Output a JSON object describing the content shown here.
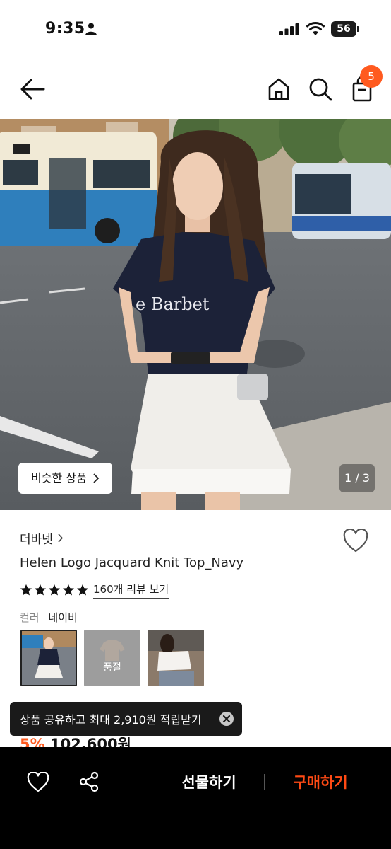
{
  "status_bar": {
    "time": "9:35",
    "battery": "56"
  },
  "nav": {
    "cart_count": "5"
  },
  "hero": {
    "similar_label": "비슷한 상품",
    "page_indicator": "1 / 3",
    "shirt_text": "e Barbet"
  },
  "product": {
    "brand": "더바넷",
    "name": "Helen Logo Jacquard Knit Top_Navy",
    "rating_stars": 5,
    "review_link": "160개 리뷰 보기",
    "color_key": "컬러",
    "color_value": "네이비",
    "soldout_label": "품절",
    "discount": "5%",
    "price": "102,600원"
  },
  "toast": {
    "message": "상품 공유하고 최대 2,910원 적립받기"
  },
  "bottom_bar": {
    "gift_label": "선물하기",
    "buy_label": "구매하기"
  },
  "colors": {
    "accent": "#ff5a1f",
    "buy": "#ff4a14",
    "bottom_bar_bg": "#000000"
  }
}
